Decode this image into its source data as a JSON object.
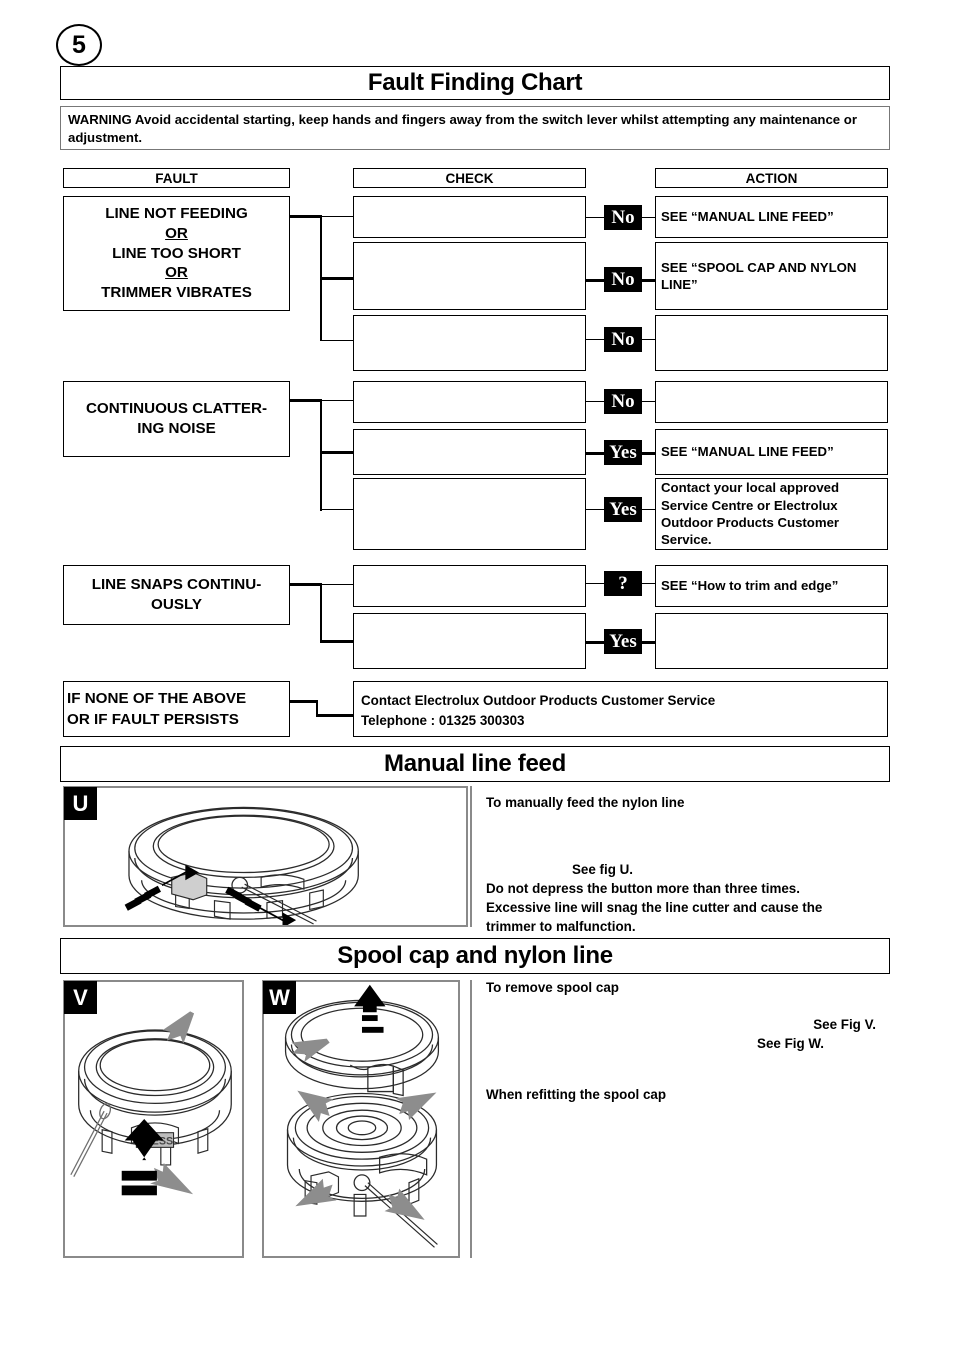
{
  "page": {
    "number": "5"
  },
  "headings": {
    "fault_chart": "Fault Finding Chart",
    "manual_line_feed": "Manual line feed",
    "spool_cap": "Spool cap and nylon line"
  },
  "warning": {
    "label": "WARNING",
    "text": "WARNING  Avoid accidental starting, keep hands and fingers away from the switch lever whilst attempting any maintenance or adjustment."
  },
  "table": {
    "columns": {
      "fault": "FAULT",
      "check": "CHECK",
      "action": "ACTION"
    },
    "faults": [
      {
        "lines": [
          "LINE NOT FEEDING",
          "OR",
          "LINE TOO SHORT",
          "OR",
          "TRIMMER VIBRATES"
        ]
      },
      {
        "lines": [
          "CONTINUOUS CLATTER-",
          "ING NOISE"
        ]
      },
      {
        "lines": [
          "LINE SNAPS CONTINU-",
          "OUSLY"
        ]
      }
    ],
    "checks": [
      "",
      "",
      "",
      "",
      "",
      "",
      "",
      ""
    ],
    "rows": [
      {
        "badge": "No",
        "action": "SEE “MANUAL LINE FEED”"
      },
      {
        "badge": "No",
        "action": "SEE “SPOOL CAP AND NYLON LINE”"
      },
      {
        "badge": "No",
        "action": ""
      },
      {
        "badge": "No",
        "action": ""
      },
      {
        "badge": "Yes",
        "action": "SEE “MANUAL LINE FEED”"
      },
      {
        "badge": "Yes",
        "action": "Contact your local approved Service Centre or Electrolux Outdoor Products Customer Service."
      },
      {
        "badge": "?",
        "action": "SEE “How to trim and edge”"
      },
      {
        "badge": "Yes",
        "action": ""
      }
    ],
    "footer": {
      "fault_line1": "IF NONE OF THE ABOVE",
      "fault_line2": "OR IF FAULT PERSISTS",
      "action_line1": "Contact Electrolux Outdoor Products Customer Service",
      "action_line2": "Telephone : 01325 300303"
    }
  },
  "manual_feed": {
    "fig_label": "U",
    "intro": "To manually feed the nylon line",
    "see_fig": "See fig U.",
    "note_line1": "Do not depress the button more than three times.",
    "note_line2": "Excessive line will snag the line cutter and cause the",
    "note_line3": "trimmer to malfunction."
  },
  "spool": {
    "fig_v_label": "V",
    "fig_w_label": "W",
    "press_label": "PRESS",
    "remove_title": "To remove spool cap",
    "see_fig_v": "See Fig V.",
    "see_fig_w": "See Fig W.",
    "refit_title": "When refitting the spool cap"
  },
  "colors": {
    "ink": "#000000",
    "panel_border": "#8a8a8a",
    "warn_border": "#777777"
  }
}
